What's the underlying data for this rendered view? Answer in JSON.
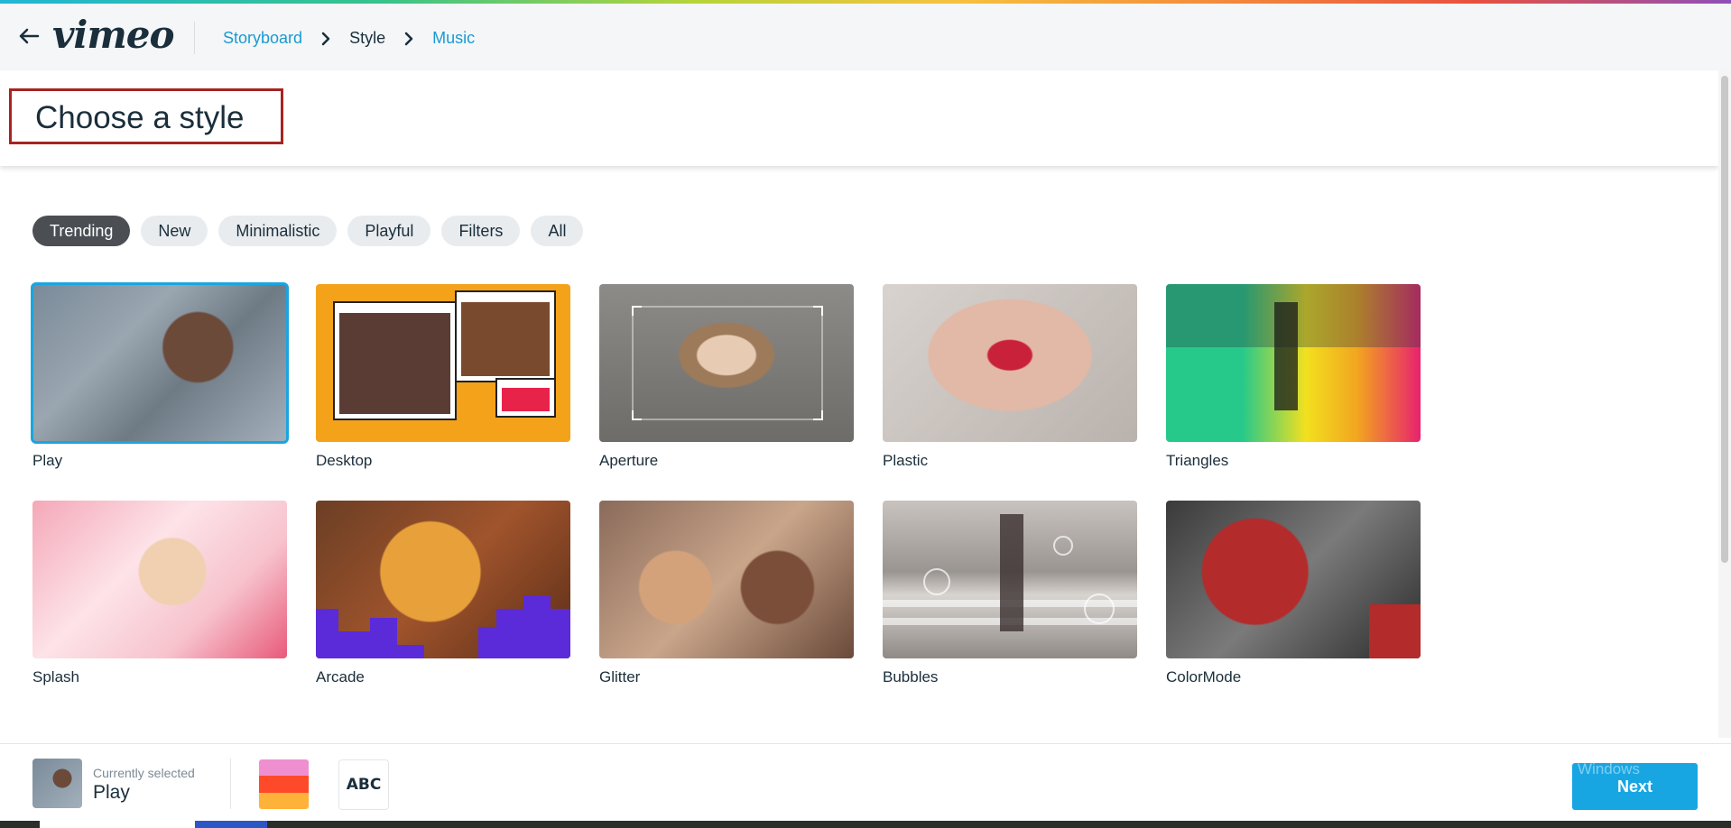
{
  "breadcrumb": {
    "items": [
      {
        "label": "Storyboard",
        "state": "link"
      },
      {
        "label": "Style",
        "state": "current"
      },
      {
        "label": "Music",
        "state": "link"
      }
    ]
  },
  "header": {
    "logo": "vimeo",
    "title": "Choose a style"
  },
  "filters": {
    "items": [
      "Trending",
      "New",
      "Minimalistic",
      "Playful",
      "Filters",
      "All"
    ],
    "active": "Trending"
  },
  "styles": [
    {
      "label": "Play",
      "selected": true
    },
    {
      "label": "Desktop"
    },
    {
      "label": "Aperture"
    },
    {
      "label": "Plastic"
    },
    {
      "label": "Triangles"
    },
    {
      "label": "Splash"
    },
    {
      "label": "Arcade"
    },
    {
      "label": "Glitter"
    },
    {
      "label": "Bubbles"
    },
    {
      "label": "ColorMode"
    }
  ],
  "footer": {
    "currently_selected_label": "Currently selected",
    "currently_selected_value": "Play",
    "palette_colors": [
      "#f08fd0",
      "#ff4a2a",
      "#ffb23a"
    ],
    "font_sample": "ABC",
    "next_label": "Next",
    "watermark": "Windows"
  },
  "colors": {
    "accent": "#18a6e3",
    "link": "#1a9bd0",
    "title_box_border": "#a62422",
    "chip_active": "#4b4f54"
  }
}
